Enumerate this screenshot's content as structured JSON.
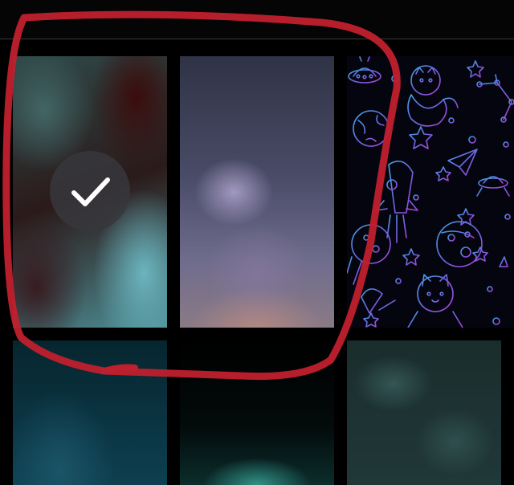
{
  "wallpapers": [
    {
      "name": "blur-teal-red",
      "selected": true
    },
    {
      "name": "blur-lavender",
      "selected": false
    },
    {
      "name": "space-doodle-pattern",
      "selected": false
    },
    {
      "name": "blur-deep-teal",
      "selected": false
    },
    {
      "name": "blur-aurora",
      "selected": false
    },
    {
      "name": "blur-smoke-teal",
      "selected": false
    }
  ],
  "icons": {
    "checkmark": "check-icon"
  },
  "colors": {
    "background": "#000000",
    "annotation": "#c0202e",
    "pattern_blue": "#3fa9e8",
    "pattern_purple": "#b03fd8"
  }
}
